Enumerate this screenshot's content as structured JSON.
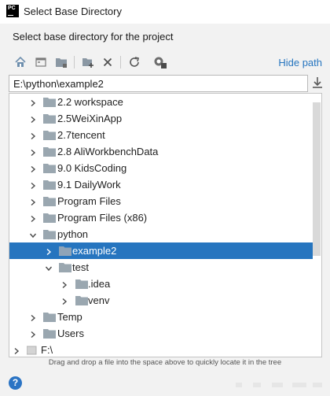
{
  "window": {
    "title": "Select Base Directory",
    "icon_text": "PC"
  },
  "subtitle": "Select base directory for the project",
  "toolbar": {
    "buttons": [
      {
        "name": "home-icon"
      },
      {
        "name": "desktop-icon"
      },
      {
        "name": "project-folder-icon"
      },
      {
        "name": "new-folder-icon"
      },
      {
        "name": "delete-icon"
      },
      {
        "name": "refresh-icon"
      },
      {
        "name": "show-hidden-icon"
      }
    ],
    "hide_path_label": "Hide path"
  },
  "path": {
    "value": "E:\\python\\example2"
  },
  "tree": [
    {
      "label": "2.2 workspace",
      "depth": 1,
      "expanded": false,
      "selected": false,
      "type": "folder"
    },
    {
      "label": "2.5WeiXinApp",
      "depth": 1,
      "expanded": false,
      "selected": false,
      "type": "folder"
    },
    {
      "label": "2.7tencent",
      "depth": 1,
      "expanded": false,
      "selected": false,
      "type": "folder"
    },
    {
      "label": "2.8 AliWorkbenchData",
      "depth": 1,
      "expanded": false,
      "selected": false,
      "type": "folder"
    },
    {
      "label": "9.0 KidsCoding",
      "depth": 1,
      "expanded": false,
      "selected": false,
      "type": "folder"
    },
    {
      "label": "9.1 DailyWork",
      "depth": 1,
      "expanded": false,
      "selected": false,
      "type": "folder"
    },
    {
      "label": "Program Files",
      "depth": 1,
      "expanded": false,
      "selected": false,
      "type": "folder"
    },
    {
      "label": "Program Files (x86)",
      "depth": 1,
      "expanded": false,
      "selected": false,
      "type": "folder"
    },
    {
      "label": "python",
      "depth": 1,
      "expanded": true,
      "selected": false,
      "type": "folder"
    },
    {
      "label": "example2",
      "depth": 2,
      "expanded": false,
      "selected": true,
      "type": "folder"
    },
    {
      "label": "test",
      "depth": 2,
      "expanded": true,
      "selected": false,
      "type": "folder"
    },
    {
      "label": ".idea",
      "depth": 3,
      "expanded": false,
      "selected": false,
      "type": "folder"
    },
    {
      "label": "venv",
      "depth": 3,
      "expanded": false,
      "selected": false,
      "type": "folder"
    },
    {
      "label": "Temp",
      "depth": 1,
      "expanded": false,
      "selected": false,
      "type": "folder"
    },
    {
      "label": "Users",
      "depth": 1,
      "expanded": false,
      "selected": false,
      "type": "folder"
    },
    {
      "label": "F:\\",
      "depth": 0,
      "expanded": false,
      "selected": false,
      "type": "drive"
    }
  ],
  "hint": "Drag and drop a file into the space above to quickly locate it in the tree",
  "help": {
    "label": "?"
  },
  "colors": {
    "accent": "#2675bf",
    "folder": "#9aa7b0",
    "link": "#2675bf"
  }
}
